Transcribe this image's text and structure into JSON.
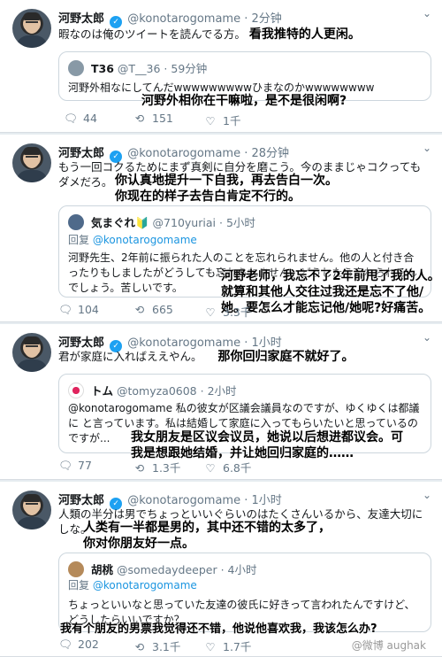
{
  "author": {
    "name": "河野太郎",
    "handle": "@konotarogomame",
    "verified_mark": "✓"
  },
  "tweets": [
    {
      "time": "2分钟",
      "text": "暇なのは俺のツイートを読んでる方。",
      "sub": "看我推特的人更闲。",
      "quote": {
        "name": "T36",
        "handle": "@T__36",
        "time": "59分钟",
        "reply_to": "",
        "reply_prefix": "",
        "text": "河野外相なにしてんだwwwwwwwwwひまなのかwwwwwwww",
        "sub": "河野外相你在干嘛啦，是不是很闲啊?"
      },
      "actions": {
        "reply": "44",
        "retweet": "151",
        "like": "1千"
      }
    },
    {
      "time": "28分钟",
      "text": "もう一回コクるためにまず真剣に自分を磨こう。今のままじゃコクってもダメだろ。",
      "sub1": "你认真地提升一下自我，再去告白一次。",
      "sub2": "你现在的样子去告白肯定不行的。",
      "quote": {
        "name": "気まぐれ🔰",
        "handle": "@710yuriai",
        "time": "5小时",
        "reply_prefix": "回复",
        "reply_to": "@konotarogomame",
        "text": "河野先生、2年前に振られた人のことを忘れられません。他の人と付き合ったりもしましたがどうしても忘れられません。どうしたら忘れられるんでしょう。苦しいです。",
        "sub1": "河野老师，我忘不了2年前甩了我的人。",
        "sub2": "就算和其他人交往过我还是忘不了他/",
        "sub3": "她。要怎么才能忘记他/她呢?好痛苦。"
      },
      "actions": {
        "reply": "104",
        "retweet": "665",
        "like": "3.3千"
      }
    },
    {
      "time": "1小时",
      "text": "君が家庭に入ればええやん。",
      "sub": "那你回归家庭不就好了。",
      "quote": {
        "name": "トム",
        "handle": "@tomyza0608",
        "time": "2小时",
        "reply_prefix": "",
        "reply_to": "",
        "text": "@konotarogomame 私の彼女が区議会議員なのですが、ゆくゆくは都議に と言っています。私は結婚して家庭に入ってもらいたいと思っているのですが...",
        "sub1": "我女朋友是区议会议员，她说以后想进都议会。可",
        "sub2": "我是想跟她结婚，并让她回归家庭的……"
      },
      "actions": {
        "reply": "77",
        "retweet": "1.3千",
        "like": "6.8千"
      }
    },
    {
      "time": "1小时",
      "text": "人類の半分は男でちょっといいぐらいのはたくさんいるから、友達大切にしな。",
      "sub1": "人类有一半都是男的，其中还不错的太多了，",
      "sub2": "你对你朋友好一点。",
      "quote": {
        "name": "胡桃",
        "handle": "@somedaydeeper",
        "time": "4小时",
        "reply_prefix": "回复",
        "reply_to": "@konotarogomame",
        "text": "ちょっといいなと思っていた友達の彼氏に好きって言われたんですけど、どうしたらいいですか？",
        "sub": "我有个朋友的男票我觉得还不错，他说他喜欢我，我该怎么办?"
      },
      "actions": {
        "reply": "202",
        "retweet": "3.1千",
        "like": "1.7千"
      }
    }
  ],
  "watermark": "@微博 aughak",
  "icons": {
    "reply": "speech-bubble",
    "retweet": "arrows-loop",
    "like": "heart"
  },
  "colors": {
    "link": "#1b95e0",
    "verified": "#1da1f2",
    "muted": "#657786"
  }
}
